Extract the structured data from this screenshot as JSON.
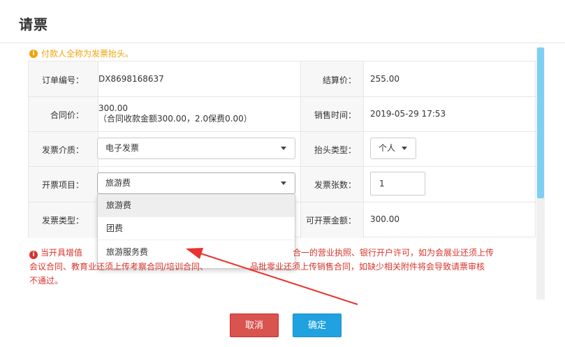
{
  "dialog": {
    "title": "请票"
  },
  "notice": "付款人全称为发票抬头。",
  "form": {
    "order_no_label": "订单编号：",
    "order_no": "DX8698168637",
    "settle_price_label": "结算价：",
    "settle_price": "255.00",
    "contract_price_label": "合同价：",
    "contract_price": "300.00",
    "contract_detail": "（合同收款金额300.00，2.0保费0.00）",
    "sale_time_label": "销售时间：",
    "sale_time": "2019-05-29 17:53",
    "medium_label": "发票介质：",
    "medium_value": "电子发票",
    "header_type_label": "抬头类型：",
    "header_type_value": "个人",
    "item_label": "开票项目：",
    "item_value": "旅游费",
    "count_label": "发票张数：",
    "count_value": "1",
    "invoice_type_label": "发票类型：",
    "available_amount_label": "可开票金额：",
    "available_amount": "300.00"
  },
  "dropdown": {
    "options": [
      "旅游费",
      "团费",
      "旅游服务费"
    ]
  },
  "warning": {
    "line1_left": "当开具增值",
    "line1_right": "合一的营业执照、银行开户许可，如为会展业还须上传",
    "line2_left": "会议合同、教育业还须上传考察合同/培训合同、",
    "line2_right": "品批零业还须上传销售合同，如缺少相关附件将会导致请票审核",
    "line3": "不通过。"
  },
  "footer": {
    "cancel_label": "取消",
    "ok_label": "确定"
  },
  "colors": {
    "notice": "#f0a30a",
    "warning": "#d8342c",
    "cancel_button": "#d9534f",
    "ok_button": "#20a2e0",
    "scrollbar": "#7ecff4",
    "annotation_arrow": "#e8322d"
  },
  "icons": {
    "notice_icon": "info-circle-icon",
    "warning_icon": "info-circle-icon",
    "select_caret": "caret-down-icon",
    "annotation": "red-arrow-annotation"
  }
}
